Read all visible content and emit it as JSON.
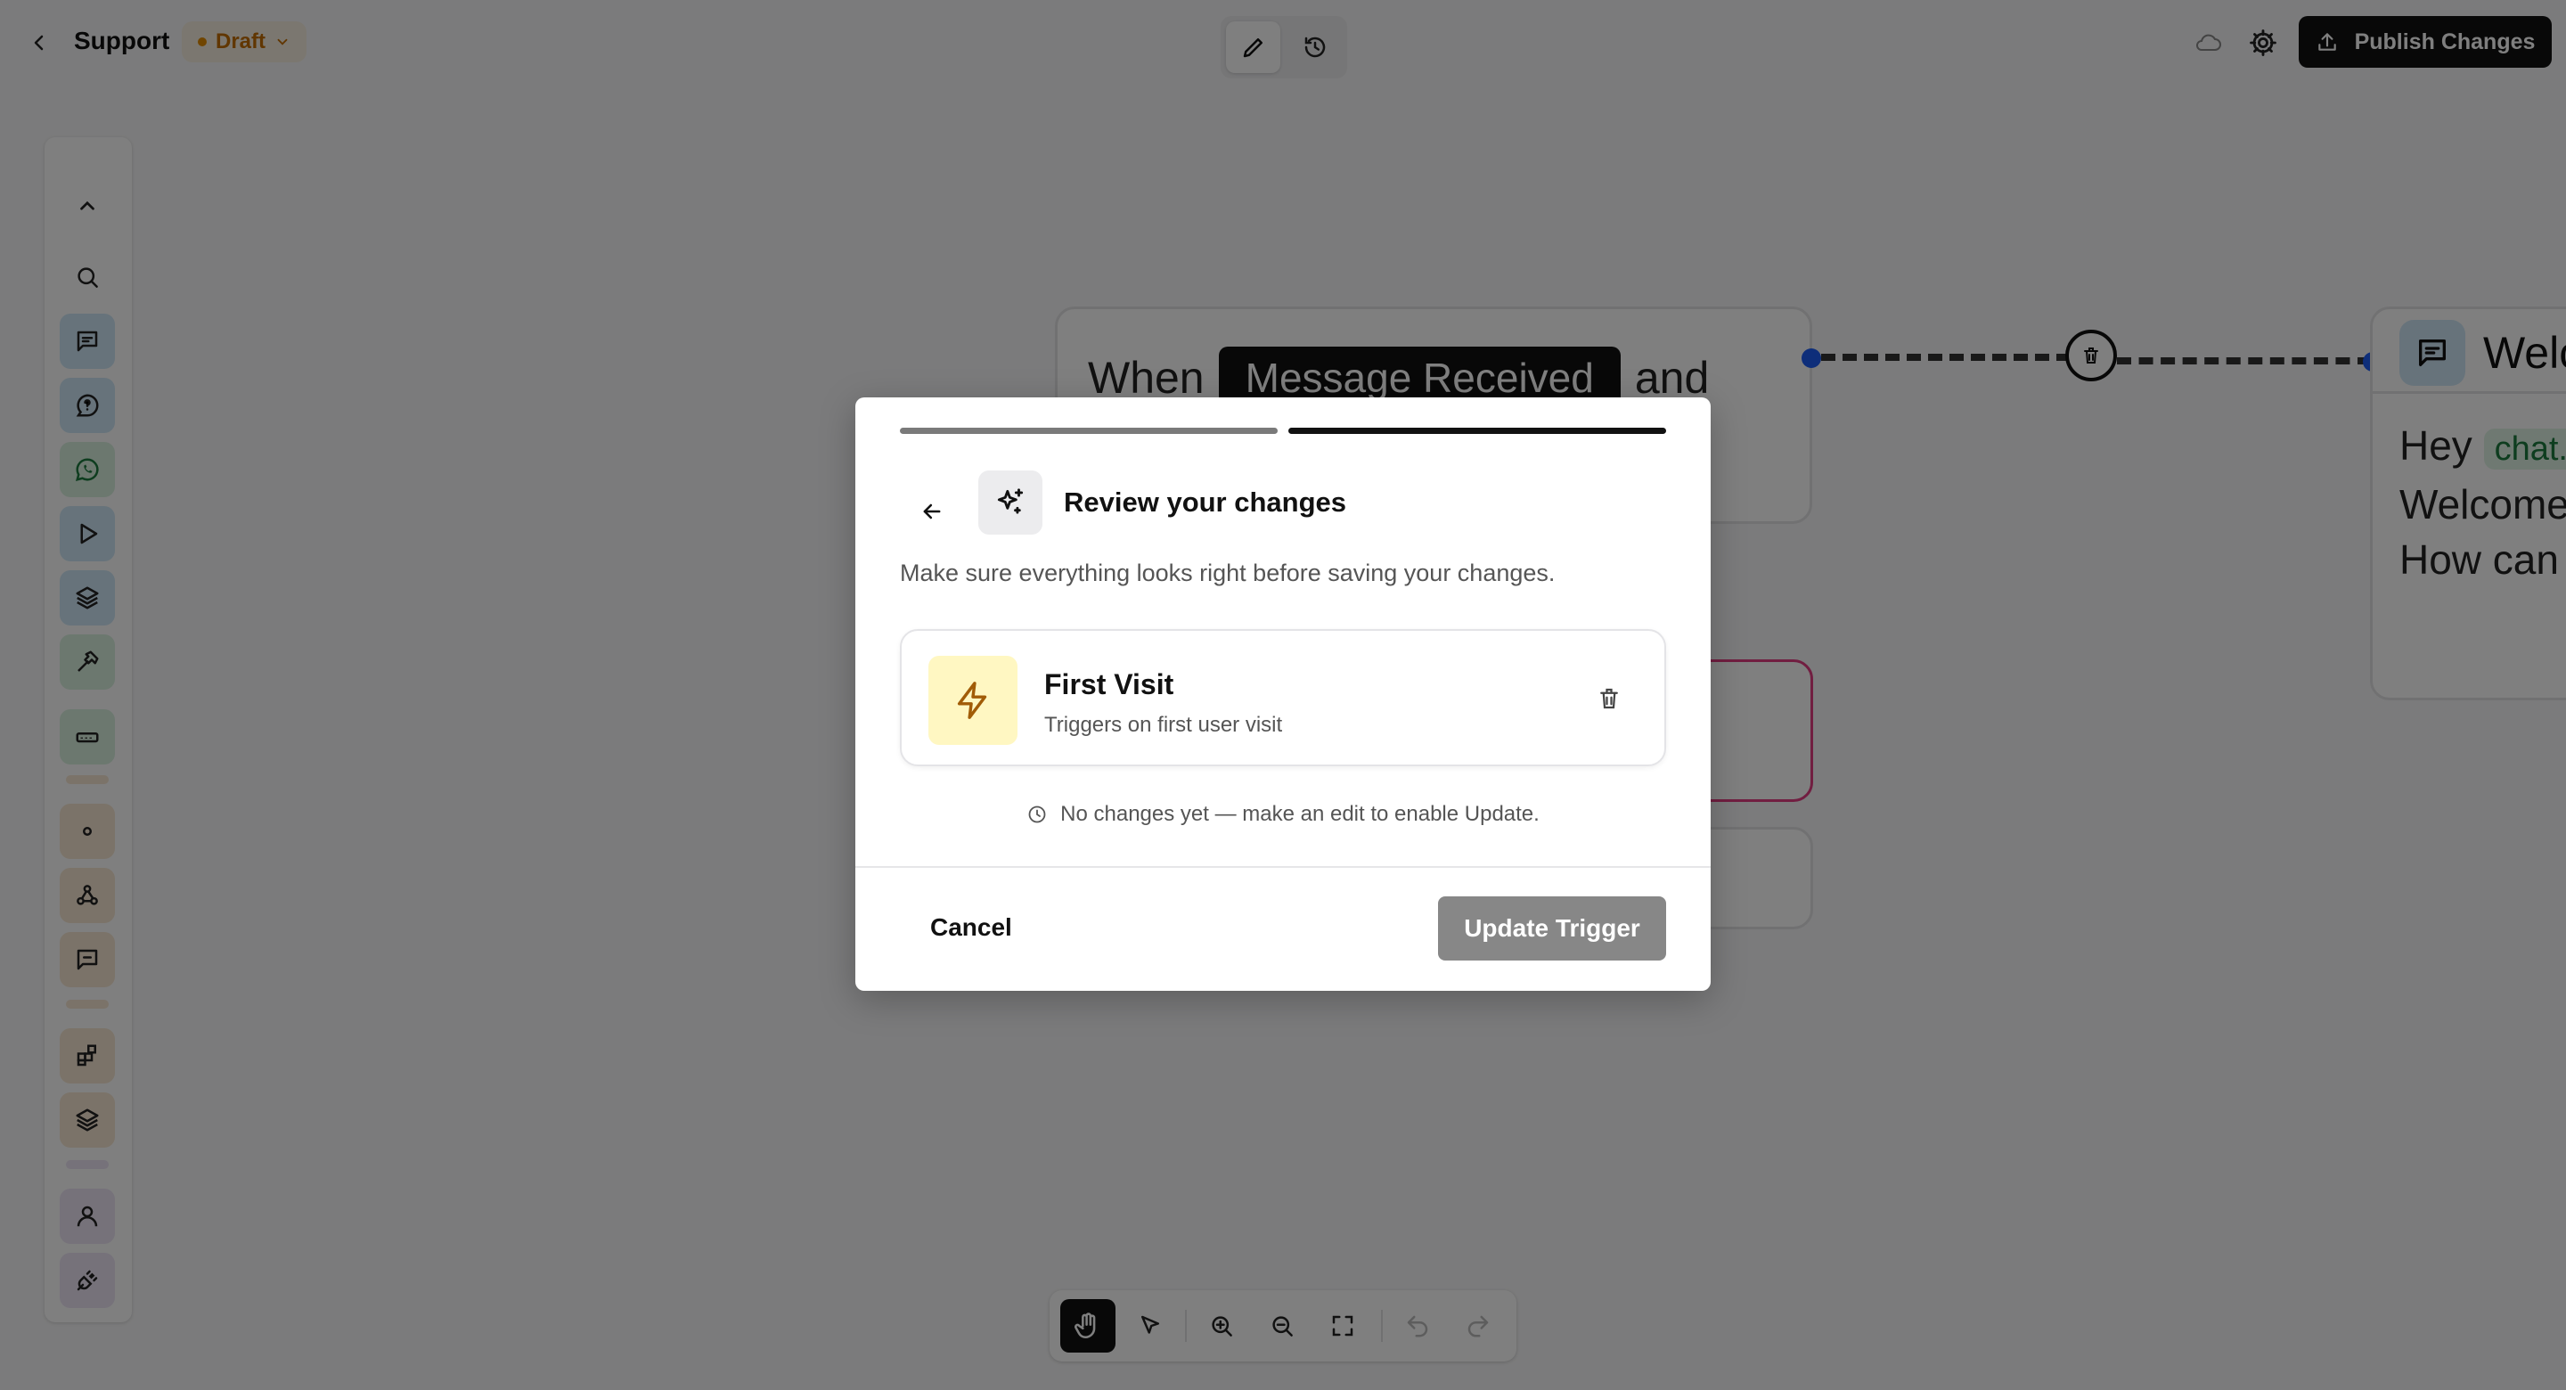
{
  "header": {
    "title": "Support",
    "status_badge": "Draft",
    "publish_label": "Publish Changes"
  },
  "canvas": {
    "trigger_node": {
      "prefix": "When",
      "event_chip": "Message Received",
      "suffix": "and"
    },
    "welcome_node": {
      "title": "Welc",
      "line1_text": "Hey",
      "line1_chip": "chat.",
      "line2": "Welcome",
      "line3": "How can"
    }
  },
  "modal": {
    "title": "Review your changes",
    "description": "Make sure everything looks right before saving your changes.",
    "trigger_card": {
      "name": "First Visit",
      "subtitle": "Triggers on first user visit"
    },
    "notice": "No changes yet — make an edit to enable Update.",
    "cancel_label": "Cancel",
    "update_label": "Update Trigger",
    "steps": {
      "total": 2,
      "current": 2
    }
  },
  "colors": {
    "rail_chat": "#cfe6f7",
    "rail_whatsapp": "#d9f0df",
    "rail_orange": "#f7e6d2",
    "rail_purple": "#ece4f5",
    "accent_connector": "#1d5cf5",
    "pink_node": "#e33d83",
    "bolt_bg": "#fff7c2",
    "bolt": "#a15c07"
  }
}
